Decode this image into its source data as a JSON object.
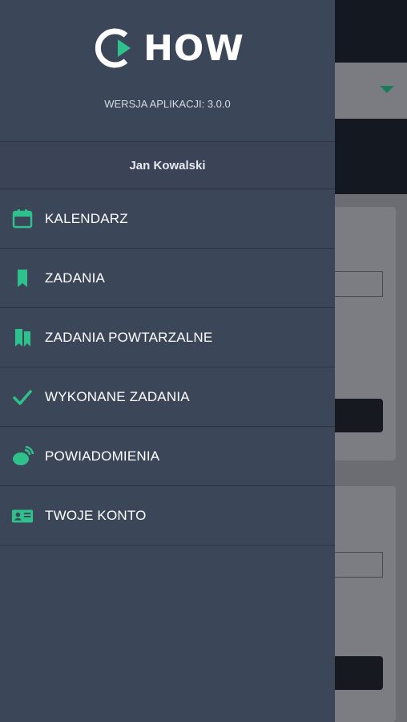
{
  "app": {
    "logo_text": "HOW",
    "version_text": "WERSJA APLIKACJI: 3.0.0",
    "user_name": "Jan Kowalski",
    "accent_color": "#2fc18b"
  },
  "menu": [
    {
      "label": "KALENDARZ",
      "icon": "calendar-icon"
    },
    {
      "label": "ZADANIA",
      "icon": "bookmark-icon"
    },
    {
      "label": "ZADANIA POWTARZALNE",
      "icon": "double-bookmark-icon"
    },
    {
      "label": "WYKONANE ZADANIA",
      "icon": "check-icon"
    },
    {
      "label": "POWIADOMIENIA",
      "icon": "notification-icon"
    },
    {
      "label": "TWOJE KONTO",
      "icon": "id-card-icon"
    }
  ]
}
